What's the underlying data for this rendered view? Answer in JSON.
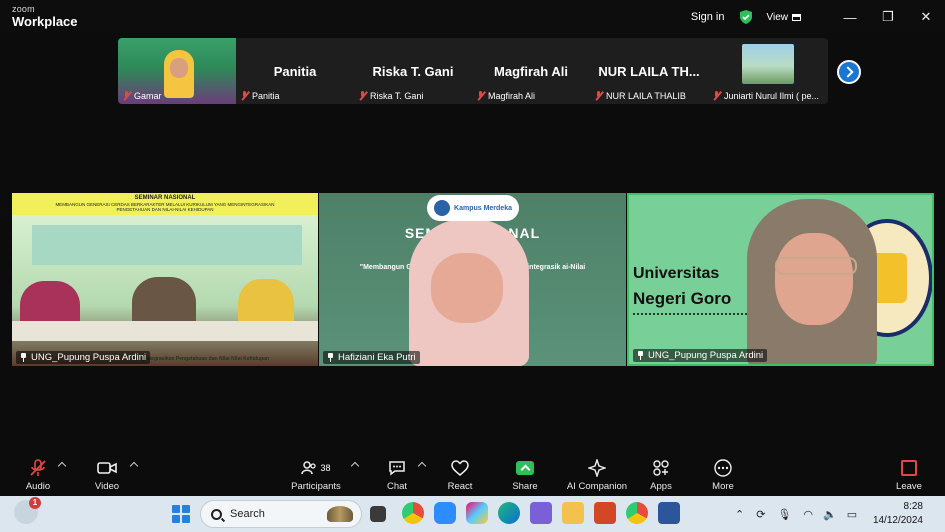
{
  "titlebar": {
    "brand_small": "zoom",
    "brand_large": "Workplace",
    "signin_label": "Sign in",
    "view_label": "View",
    "minimize_glyph": "—",
    "maximize_glyph": "❐",
    "close_glyph": "✕"
  },
  "strip": {
    "tiles": [
      {
        "name": "",
        "label": "Gamar",
        "has_video": true
      },
      {
        "name": "Panitia",
        "label": "Panitia"
      },
      {
        "name": "Riska T. Gani",
        "label": "Riska T. Gani"
      },
      {
        "name": "Magfirah Ali",
        "label": "Magfirah Ali"
      },
      {
        "name": "NUR LAILA TH...",
        "label": "NUR LAILA THALIB"
      },
      {
        "name": "",
        "label": "Juniarti Nurul Ilmi ( pe...",
        "has_photo": true
      }
    ]
  },
  "gallery": {
    "tiles": [
      {
        "label": "UNG_Pupung Puspa Ardini",
        "banner_title": "SEMINAR NASIONAL",
        "banner_sub": "MEMBANGUN GENERASI CERDAS BERKARAKTER MELALUI KURIKULUM YANG MENGINTEGRASIKAN PENGETAHUAN DAN NILAI-NILAI KEHIDUPAN",
        "bottom_text": "Mengintegrasikan Pengetahuan dan Nilai-Nilai Kehidupan"
      },
      {
        "label": "Hafiziani Eka Putri",
        "badge_text": "Kampus Merdeka",
        "seminar_text": "SEMIN        NASIONAL",
        "tagline": "\"Membangun Gener               Melalui Kurikulum yang Mengintegrasik               ai-Nilai Kehidupan\""
      },
      {
        "label": "UNG_Pupung Puspa Ardini",
        "uni_line1": "Universitas",
        "uni_line2": "Negeri Goro",
        "active_speaker": true
      }
    ]
  },
  "toolbar": {
    "audio": "Audio",
    "video": "Video",
    "participants": "Participants",
    "participants_count": "38",
    "chat": "Chat",
    "react": "React",
    "share": "Share",
    "ai_companion": "AI Companion",
    "apps": "Apps",
    "more": "More",
    "leave": "Leave"
  },
  "taskbar": {
    "notification_count": "1",
    "search_placeholder": "Search",
    "clock_time": "8:28",
    "clock_date": "14/12/2024"
  },
  "colors": {
    "accent_blue": "#1976d2",
    "muted_red": "#e04848",
    "share_green": "#2fbf5a",
    "active_speaker_border": "#3fbf6a"
  }
}
